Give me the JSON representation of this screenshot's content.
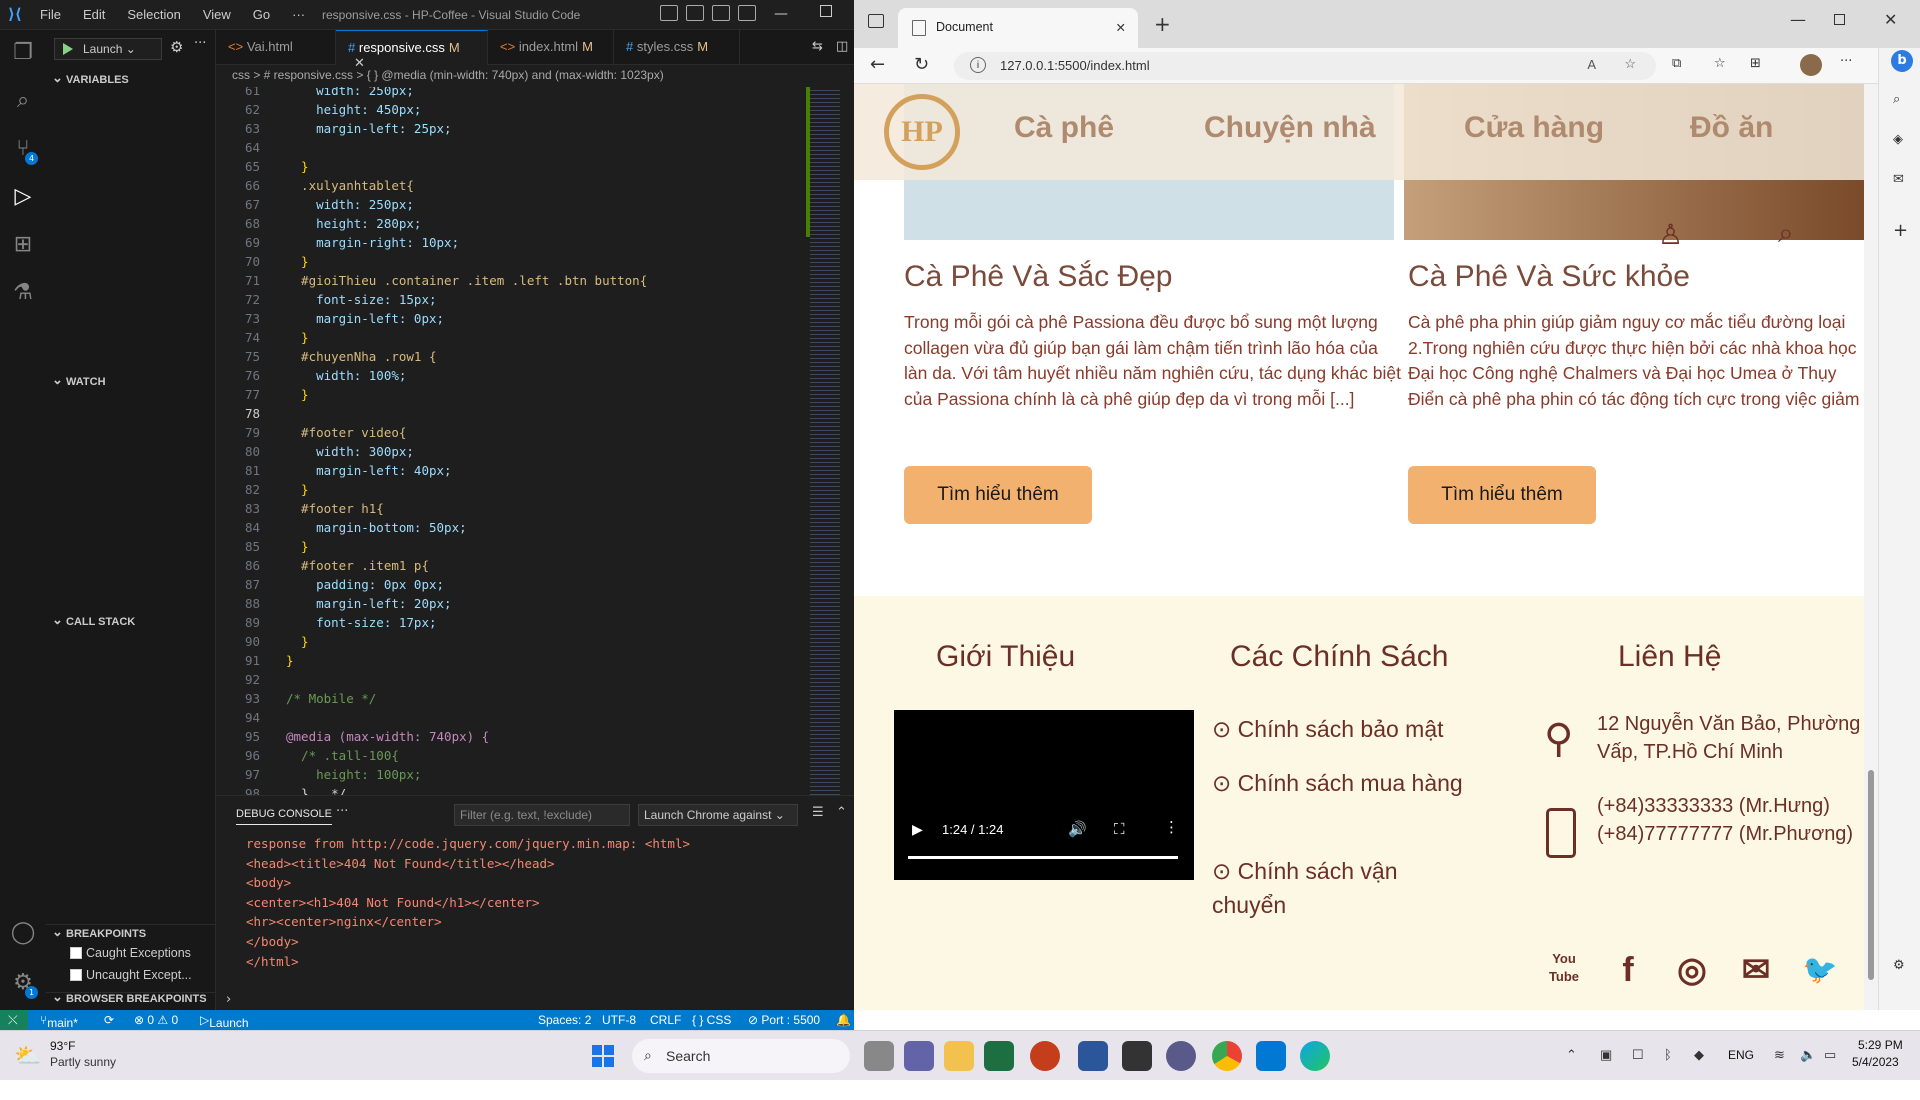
{
  "vscode": {
    "window_title": "responsive.css - HP-Coffee - Visual Studio Code",
    "menu": [
      "File",
      "Edit",
      "Selection",
      "View",
      "Go",
      "···"
    ],
    "launch_label": "Launch",
    "sections": {
      "variables": "VARIABLES",
      "watch": "WATCH",
      "call_stack": "CALL STACK",
      "breakpoints": "BREAKPOINTS",
      "browser_breakpoints": "BROWSER BREAKPOINTS"
    },
    "breakpoints": [
      "Caught Exceptions",
      "Uncaught Except..."
    ],
    "tabs": [
      {
        "label": "Vai.html",
        "mod": ""
      },
      {
        "label": "responsive.css",
        "mod": "M"
      },
      {
        "label": "index.html",
        "mod": "M"
      },
      {
        "label": "styles.css",
        "mod": "M"
      }
    ],
    "breadcrumb": "css > # responsive.css > { } @media (min-width: 740px) and (max-width: 1023px)",
    "line_numbers": [
      "61",
      "62",
      "63",
      "64",
      "65",
      "66",
      "67",
      "68",
      "69",
      "70",
      "71",
      "72",
      "73",
      "74",
      "75",
      "76",
      "77",
      "78",
      "79",
      "80",
      "81",
      "82",
      "83",
      "84",
      "85",
      "86",
      "87",
      "88",
      "89",
      "90",
      "91",
      "92",
      "93",
      "94",
      "95",
      "96",
      "97",
      "98"
    ],
    "code_lines": [
      "    width: 250px;",
      "    height: 450px;",
      "    margin-left: 25px;",
      "",
      "  }",
      "  .xulyanhtablet{",
      "    width: 250px;",
      "    height: 280px;",
      "    margin-right: 10px;",
      "  }",
      "  #gioiThieu .container .item .left .btn button{",
      "    font-size: 15px;",
      "    margin-left: 0px;",
      "  }",
      "  #chuyenNha .row1 {",
      "    width: 100%;",
      "  }",
      "",
      "  #footer video{",
      "    width: 300px;",
      "    margin-left: 40px;",
      "  }",
      "  #footer h1{",
      "    margin-bottom: 50px;",
      "  }",
      "  #footer .item1 p{",
      "    padding: 0px 0px;",
      "    margin-left: 20px;",
      "    font-size: 17px;",
      "  }",
      "}",
      "",
      "/* Mobile */",
      "",
      "@media (max-width: 740px) {",
      "  /* .tall-100{",
      "    height: 100px;",
      "  }   */"
    ],
    "panel_tab": "DEBUG CONSOLE",
    "filter_placeholder": "Filter (e.g. text, !exclude)",
    "session": "Launch Chrome against",
    "console_lines": [
      "response from http://code.jquery.com/jquery.min.map: <html>",
      "<head><title>404 Not Found</title></head>",
      "<body>",
      "<center><h1>404 Not Found</h1></center>",
      "<hr><center>nginx</center>",
      "</body>",
      "</html>"
    ],
    "status": {
      "branch": "main*",
      "problems": "⊗ 0 ⚠ 0",
      "debug": "Launch Chrome against localhost (HP-Coffee)",
      "spaces": "Spaces: 2",
      "encoding": "UTF-8",
      "eol": "CRLF",
      "lang": "{ } CSS",
      "port": "⊘ Port : 5500"
    }
  },
  "browser": {
    "tab_title": "Document",
    "url": "127.0.0.1:5500/index.html",
    "nav": [
      "Cà phê",
      "Chuyện nhà",
      "Cửa hàng",
      "Đồ ăn"
    ],
    "logo_text": "HP",
    "articles": [
      {
        "title": "Cà Phê Và Sắc Đẹp",
        "text": "Trong mỗi gói cà phê Passiona đều được bổ sung một lượng collagen vừa đủ giúp bạn gái làm chậm tiến trình lão hóa của làn da. Với tâm huyết nhiều năm nghiên cứu, tác dụng khác biệt của Passiona chính là cà phê giúp đẹp da vì trong mỗi [...]",
        "button": "Tìm hiểu thêm"
      },
      {
        "title": "Cà Phê Và Sức khỏe",
        "text": "Cà phê pha phin giúp giảm nguy cơ mắc tiểu đường loại 2.Trong nghiên cứu được thực hiện bởi các nhà khoa học Đại học Công nghệ Chalmers và Đại học Umea ở Thụy Điển cà phê pha phin có tác động tích cực trong việc giảm ngu",
        "button": "Tìm hiểu thêm"
      }
    ],
    "footer": {
      "headings": [
        "Giới Thiệu",
        "Các Chính Sách",
        "Liên Hệ"
      ],
      "video_time": "1:24 / 1:24",
      "policies": [
        "Chính sách bảo mật",
        "Chính sách mua hàng",
        "Chính sách vận chuyển"
      ],
      "address": [
        "12 Nguyễn Văn Bảo, Phường",
        "Vấp, TP.Hồ Chí Minh"
      ],
      "phones": [
        "(+84)33333333 (Mr.Hưng)",
        "(+84)77777777 (Mr.Phương)"
      ],
      "social": [
        "You Tube",
        "f",
        "◎",
        "✉",
        "🐦"
      ]
    }
  },
  "taskbar": {
    "weather_temp": "93°F",
    "weather_desc": "Partly sunny",
    "search": "Search",
    "lang": "ENG",
    "time": "5:29 PM",
    "date": "5/4/2023"
  }
}
